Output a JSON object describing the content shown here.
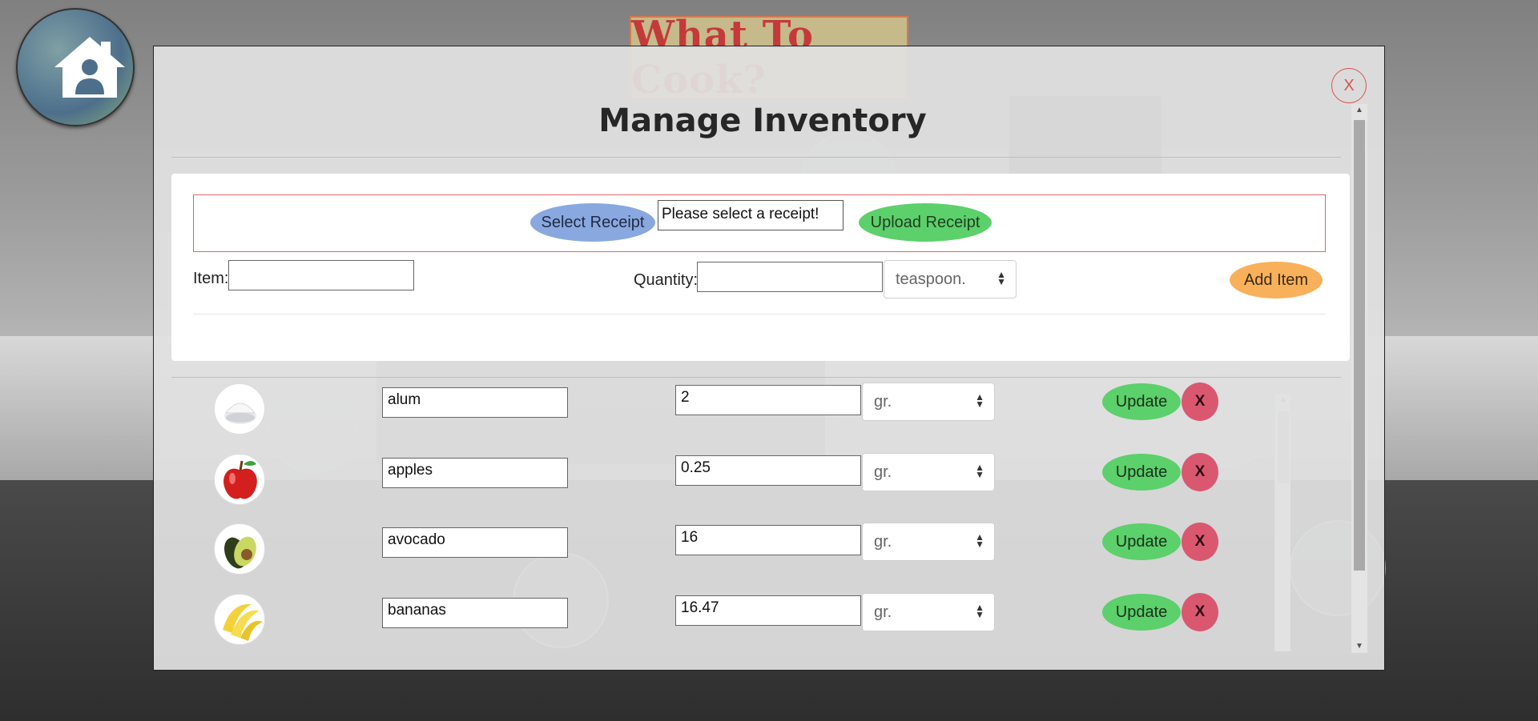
{
  "app": {
    "brand_title": "What To Cook?"
  },
  "modal": {
    "title": "Manage Inventory",
    "close_label": "X"
  },
  "receipt": {
    "select_label": "Select Receipt",
    "file_status": "Please select a receipt!",
    "upload_label": "Upload Receipt"
  },
  "add_form": {
    "item_label": "Item:",
    "item_value": "",
    "quantity_label": "Quantity:",
    "quantity_value": "",
    "unit_selected": "teaspoon.",
    "add_label": "Add Item"
  },
  "inventory": {
    "update_label": "Update",
    "delete_label": "X",
    "items": [
      {
        "name": "alum",
        "quantity": "2",
        "unit": "gr.",
        "icon": "alum-powder-icon"
      },
      {
        "name": "apples",
        "quantity": "0.25",
        "unit": "gr.",
        "icon": "apple-icon"
      },
      {
        "name": "avocado",
        "quantity": "16",
        "unit": "gr.",
        "icon": "avocado-icon"
      },
      {
        "name": "bananas",
        "quantity": "16.47",
        "unit": "gr.",
        "icon": "banana-icon"
      }
    ]
  },
  "colors": {
    "select_receipt": "#89a8df",
    "upload_receipt": "#5cd06a",
    "add_item": "#f9b05a",
    "update": "#5cd06a",
    "delete": "#d9586f",
    "receipt_border": "#e06666"
  }
}
